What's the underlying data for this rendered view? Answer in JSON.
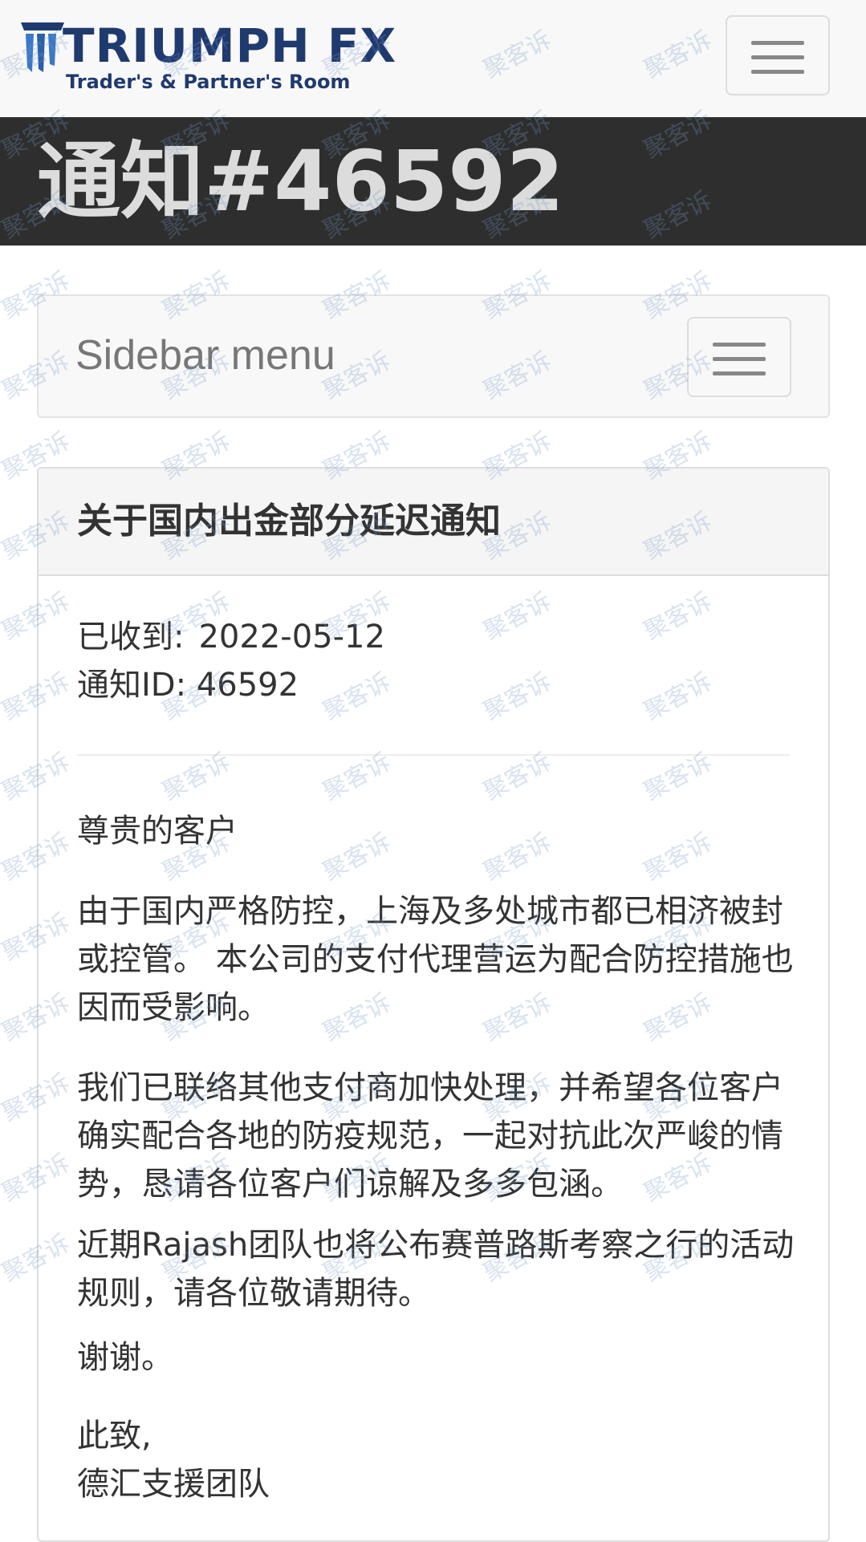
{
  "navbar": {
    "logo_title": "TRIUMPH FX",
    "logo_subtitle": "Trader's & Partner's Room",
    "toggle_icon": "hamburger-menu-icon"
  },
  "page": {
    "title": "通知#46592"
  },
  "sidebar": {
    "label": "Sidebar menu",
    "toggle_icon": "hamburger-menu-icon"
  },
  "notice": {
    "title": "关于国内出金部分延迟通知",
    "received_label": "已收到:",
    "received_date": "2022-05-12",
    "id_label": "通知ID:",
    "id_value": "46592",
    "greeting": "尊贵的客户",
    "paragraphs": [
      "由于国内严格防控，上海及多处城市都已相济被封或控管。 本公司的支付代理营运为配合防控措施也因而受影响。",
      "我们已联络其他支付商加快处理，并希望各位客户确实配合各地的防疫规范，一起对抗此次严峻的情势，恳请各位客户们谅解及多多包涵。",
      "近期Rajash团队也将公布赛普路斯考察之行的活动规则，请各位敬请期待。"
    ],
    "thanks": "谢谢。",
    "closing": "此致,",
    "signature": "德汇支援团队"
  },
  "watermark": {
    "text": "聚客诉"
  },
  "colors": {
    "brand_navy": "#1f3a6e",
    "brand_blue": "#3a78c8",
    "title_bar": "#2e2e2e",
    "navbar_bg": "#f8f8f8"
  }
}
